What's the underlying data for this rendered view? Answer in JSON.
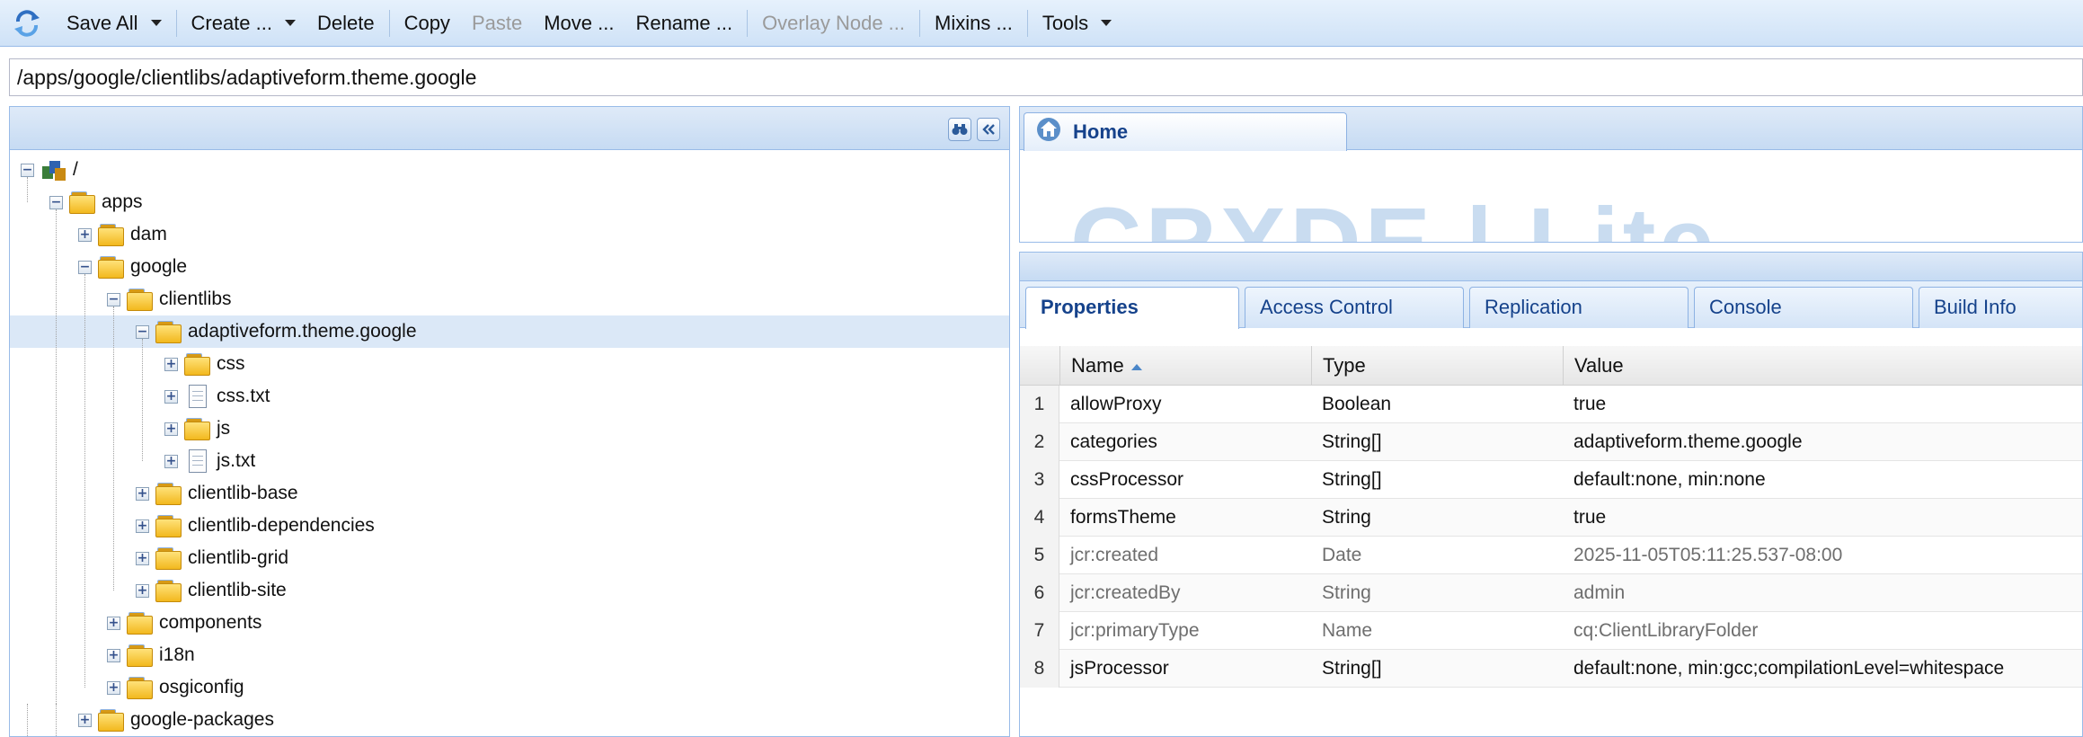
{
  "toolbar": {
    "save_all": "Save All",
    "create": "Create ...",
    "delete": "Delete",
    "copy": "Copy",
    "paste": "Paste",
    "move": "Move ...",
    "rename": "Rename ...",
    "overlay_node": "Overlay Node ...",
    "mixins": "Mixins ...",
    "tools": "Tools"
  },
  "path": "/apps/google/clientlibs/adaptiveform.theme.google",
  "tree": [
    {
      "label": "/",
      "depth": 0,
      "icon": "repository-icon",
      "expander": "minus"
    },
    {
      "label": "apps",
      "depth": 1,
      "icon": "folder-icon",
      "expander": "minus"
    },
    {
      "label": "dam",
      "depth": 2,
      "icon": "folder-icon",
      "expander": "plus"
    },
    {
      "label": "google",
      "depth": 2,
      "icon": "folder-icon",
      "expander": "minus"
    },
    {
      "label": "clientlibs",
      "depth": 3,
      "icon": "folder-icon",
      "expander": "minus"
    },
    {
      "label": "adaptiveform.theme.google",
      "depth": 4,
      "icon": "folder-icon",
      "expander": "minus",
      "selected": true
    },
    {
      "label": "css",
      "depth": 5,
      "icon": "folder-icon",
      "expander": "plus"
    },
    {
      "label": "css.txt",
      "depth": 5,
      "icon": "file-icon",
      "expander": "plus"
    },
    {
      "label": "js",
      "depth": 5,
      "icon": "folder-icon",
      "expander": "plus"
    },
    {
      "label": "js.txt",
      "depth": 5,
      "icon": "file-icon",
      "expander": "plus"
    },
    {
      "label": "clientlib-base",
      "depth": 4,
      "icon": "folder-icon",
      "expander": "plus"
    },
    {
      "label": "clientlib-dependencies",
      "depth": 4,
      "icon": "folder-icon",
      "expander": "plus"
    },
    {
      "label": "clientlib-grid",
      "depth": 4,
      "icon": "folder-icon",
      "expander": "plus"
    },
    {
      "label": "clientlib-site",
      "depth": 4,
      "icon": "folder-icon",
      "expander": "plus"
    },
    {
      "label": "components",
      "depth": 3,
      "icon": "folder-icon",
      "expander": "plus"
    },
    {
      "label": "i18n",
      "depth": 3,
      "icon": "folder-icon",
      "expander": "plus"
    },
    {
      "label": "osgiconfig",
      "depth": 3,
      "icon": "folder-icon",
      "expander": "plus"
    },
    {
      "label": "google-packages",
      "depth": 2,
      "icon": "folder-icon",
      "expander": "plus"
    }
  ],
  "home_tab": {
    "label": "Home",
    "logo_text": "CRXDE | Lite"
  },
  "tabs": [
    "Properties",
    "Access Control",
    "Replication",
    "Console",
    "Build Info"
  ],
  "properties": {
    "columns": [
      "Name",
      "Type",
      "Value"
    ],
    "rows": [
      {
        "num": "1",
        "name": "allowProxy",
        "type": "Boolean",
        "value": "true",
        "protected": false
      },
      {
        "num": "2",
        "name": "categories",
        "type": "String[]",
        "value": "adaptiveform.theme.google",
        "protected": false
      },
      {
        "num": "3",
        "name": "cssProcessor",
        "type": "String[]",
        "value": "default:none, min:none",
        "protected": false
      },
      {
        "num": "4",
        "name": "formsTheme",
        "type": "String",
        "value": "true",
        "protected": false
      },
      {
        "num": "5",
        "name": "jcr:created",
        "type": "Date",
        "value": "2025-11-05T05:11:25.537-08:00",
        "protected": true
      },
      {
        "num": "6",
        "name": "jcr:createdBy",
        "type": "String",
        "value": "admin",
        "protected": true
      },
      {
        "num": "7",
        "name": "jcr:primaryType",
        "type": "Name",
        "value": "cq:ClientLibraryFolder",
        "protected": true
      },
      {
        "num": "8",
        "name": "jsProcessor",
        "type": "String[]",
        "value": "default:none, min:gcc;compilationLevel=whitespace",
        "protected": false
      }
    ]
  }
}
